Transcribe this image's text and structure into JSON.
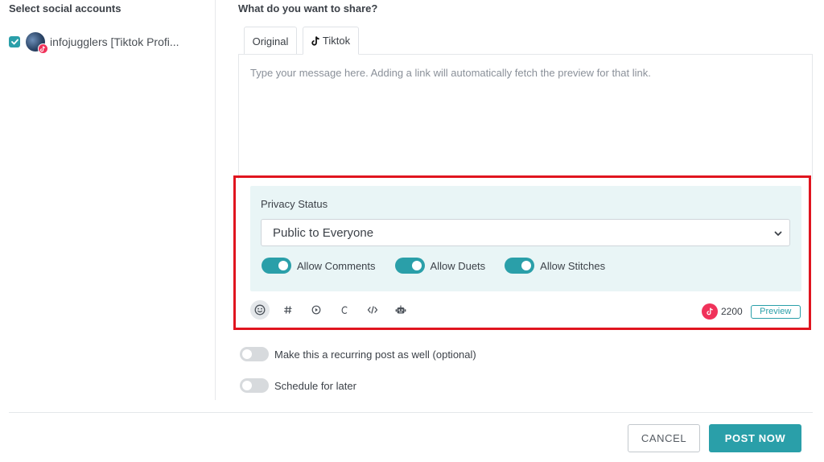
{
  "accounts_panel": {
    "heading": "Select social accounts",
    "accounts": [
      {
        "name": "infojugglers [Tiktok Profi...",
        "checked": true,
        "network": "tiktok"
      }
    ]
  },
  "composer": {
    "heading": "What do you want to share?",
    "tabs": [
      {
        "label": "Original",
        "active": false
      },
      {
        "label": "Tiktok",
        "active": true,
        "icon": "tiktok-icon"
      }
    ],
    "message_placeholder": "Type your message here. Adding a link will automatically fetch the preview for that link."
  },
  "tiktok_options": {
    "privacy_label": "Privacy Status",
    "privacy_value": "Public to Everyone",
    "toggles": [
      {
        "label": "Allow Comments",
        "on": true
      },
      {
        "label": "Allow Duets",
        "on": true
      },
      {
        "label": "Allow Stitches",
        "on": true
      }
    ]
  },
  "toolbar": {
    "tools": [
      "emoji-icon",
      "hashtag-icon",
      "media-icon",
      "caption-icon",
      "code-icon",
      "robot-icon"
    ],
    "char_count": "2200",
    "preview_label": "Preview"
  },
  "options": {
    "recurring_label": "Make this a recurring post as well (optional)",
    "schedule_label": "Schedule for later"
  },
  "footer": {
    "cancel_label": "CANCEL",
    "post_label": "POST NOW"
  },
  "colors": {
    "accent": "#2a9fa9",
    "highlight": "#e0151f",
    "tiktok_badge": "#f0325a",
    "panel_bg": "#e9f5f6"
  }
}
